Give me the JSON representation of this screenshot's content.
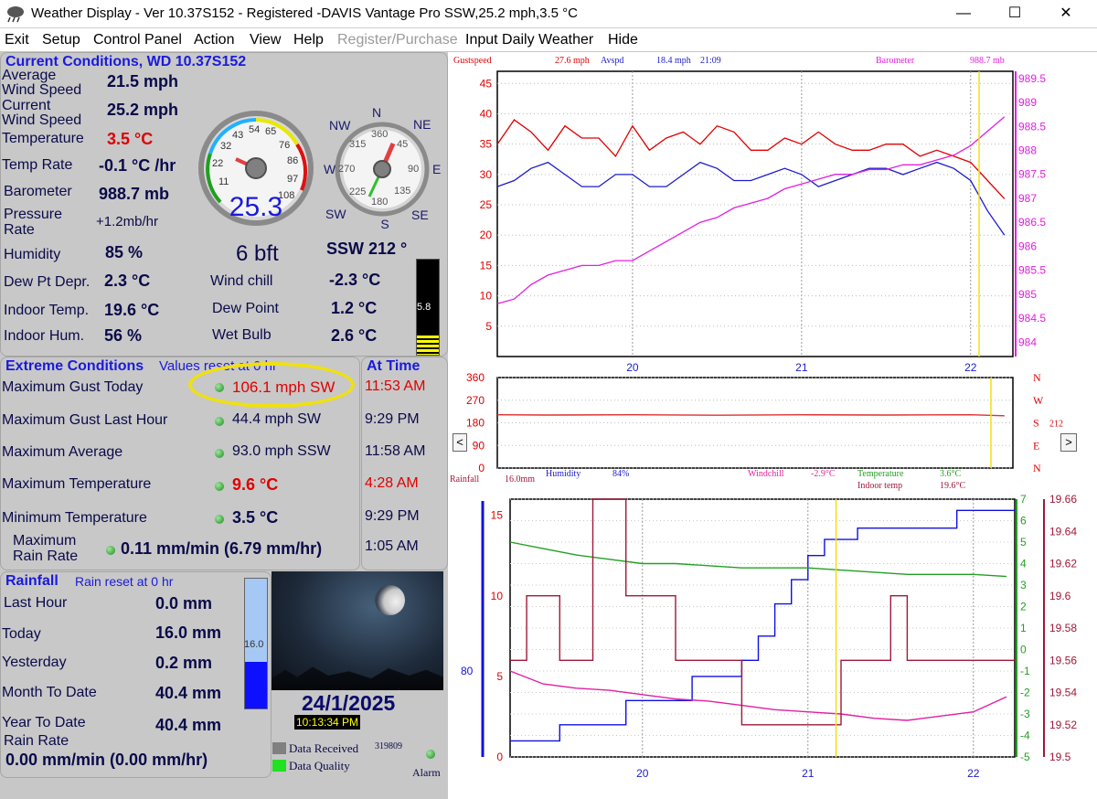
{
  "window": {
    "title": "Weather Display - Ver 10.37S152 - Registered  -DAVIS Vantage Pro SSW,25.2 mph,3.5 °C",
    "minimize": "—",
    "maximize": "☐",
    "close": "✕"
  },
  "menu": [
    "Exit",
    "Setup",
    "Control Panel",
    "Action",
    "View",
    "Help",
    "Register/Purchase",
    "Input Daily Weather",
    "Hide"
  ],
  "current": {
    "header": "Current Conditions, WD 10.37S152",
    "avg_wind_label": "Average\nWind Speed",
    "avg_wind": "21.5 mph",
    "cur_wind_label": "Current\nWind Speed",
    "cur_wind": "25.2 mph",
    "temp_label": "Temperature",
    "temp": "3.5 °C",
    "temp_rate_label": "Temp Rate",
    "temp_rate": "-0.1 °C /hr",
    "baro_label": "Barometer",
    "baro": "988.7 mb",
    "press_rate_label": "Pressure\nRate",
    "press_rate": "+1.2mb/hr",
    "humidity_label": "Humidity",
    "humidity": "85 %",
    "dewdep_label": "Dew Pt Depr.",
    "dewdep": "2.3 °C",
    "indoor_temp_label": "Indoor Temp.",
    "indoor_temp": "19.6 °C",
    "indoor_hum_label": "Indoor Hum.",
    "indoor_hum": "56 %",
    "bft": "6 bft",
    "windchill_label": "Wind chill",
    "windchill": "-2.3 °C",
    "dewpoint_label": "Dew Point",
    "dewpoint": "1.2 °C",
    "wetbulb_label": "Wet Bulb",
    "wetbulb": "2.6 °C",
    "direction": "SSW  212 °",
    "gauge_speed": "25.3",
    "gauge_ticks": [
      "11",
      "22",
      "32",
      "43",
      "54",
      "65",
      "76",
      "86",
      "97",
      "108"
    ],
    "compass_N": "N",
    "compass_NE": "NE",
    "compass_E": "E",
    "compass_SE": "SE",
    "compass_S": "S",
    "compass_SW": "SW",
    "compass_W": "W",
    "compass_NW": "NW",
    "compass_ticks": [
      "360",
      "45",
      "90",
      "135",
      "180",
      "225",
      "270",
      "315"
    ],
    "bar_value": "5.8",
    "bar_level": 0.2
  },
  "extreme": {
    "header": "Extreme Conditions",
    "sub": "Values reset at 0 hr",
    "at_time_header": "At Time",
    "rows": [
      {
        "label": "Maximum Gust Today",
        "value": "106.1 mph  SW",
        "time": "11:53 AM"
      },
      {
        "label": "Maximum Gust Last Hour",
        "value": "44.4 mph  SW",
        "time": "9:29 PM"
      },
      {
        "label": "Maximum Average",
        "value": "93.0 mph SSW",
        "time": "11:58 AM"
      },
      {
        "label": "Maximum Temperature",
        "value": "9.6 °C",
        "time": "4:28 AM"
      },
      {
        "label": "Minimum Temperature",
        "value": "3.5 °C",
        "time": "9:29 PM"
      },
      {
        "label": "Maximum\nRain Rate",
        "value": "0.11 mm/min (6.79 mm/hr)",
        "time": "1:05 AM"
      }
    ]
  },
  "rain": {
    "header": "Rainfall",
    "sub": "Rain reset at 0 hr",
    "last_hour_label": "Last Hour",
    "last_hour": "0.0 mm",
    "today_label": "Today",
    "today": "16.0 mm",
    "yesterday_label": "Yesterday",
    "yesterday": "0.2 mm",
    "month_label": "Month To Date",
    "month": "40.4 mm",
    "year_label": "Year To Date",
    "year": "40.4 mm",
    "rate_label": "Rain Rate",
    "rate": "0.00 mm/min (0.00 mm/hr)",
    "bar_value": "16.0",
    "bar_level": 0.36
  },
  "moon": {
    "date": "24/1/2025",
    "time": "10:13:34 PM"
  },
  "status": {
    "data_received_label": "Data Received",
    "data_quality_label": "Data Quality",
    "packets": "319809",
    "alarm_label": "Alarm"
  },
  "colors": {
    "gust": "#e00000",
    "avg": "#1c1ccc",
    "baro": "#e020e0",
    "dir": "#e03030",
    "green": "#22a022",
    "darkred": "#a01838",
    "blue": "#1010e0"
  },
  "chart_data": [
    {
      "type": "line",
      "title": "",
      "legend": [
        {
          "label": "Gustspeed",
          "value": "27.6 mph"
        },
        {
          "label": "Avspd",
          "value": "18.4 mph"
        },
        {
          "label": "21:09",
          "value": ""
        },
        {
          "label": "Barometer",
          "value": "988.7 mb"
        }
      ],
      "x_ticks": [
        "20",
        "21",
        "22"
      ],
      "xlim": [
        19.2,
        22.25
      ],
      "y_left_ticks": [
        "5",
        "10",
        "15",
        "20",
        "25",
        "30",
        "35",
        "40",
        "45"
      ],
      "ylim_left": [
        0,
        47
      ],
      "y_right_ticks": [
        "984",
        "984.5",
        "985",
        "985.5",
        "986",
        "986.5",
        "987",
        "987.5",
        "988",
        "988.5",
        "989",
        "989.5"
      ],
      "ylim_right": [
        983.7,
        989.65
      ],
      "series": [
        {
          "name": "Gustspeed",
          "axis": "left",
          "x": [
            19.2,
            19.3,
            19.4,
            19.5,
            19.6,
            19.7,
            19.8,
            19.9,
            20.0,
            20.1,
            20.2,
            20.3,
            20.4,
            20.5,
            20.6,
            20.7,
            20.8,
            20.9,
            21.0,
            21.1,
            21.2,
            21.3,
            21.4,
            21.5,
            21.6,
            21.7,
            21.8,
            21.9,
            22.0,
            22.1,
            22.2
          ],
          "y": [
            35,
            39,
            37,
            34,
            38,
            36,
            36,
            33,
            38,
            34,
            36,
            37,
            35,
            38,
            37,
            34,
            34,
            36,
            35,
            37,
            35,
            34,
            34,
            35,
            35,
            33,
            34,
            33,
            32,
            29,
            26
          ]
        },
        {
          "name": "Avspd",
          "axis": "left",
          "x": [
            19.2,
            19.3,
            19.4,
            19.5,
            19.6,
            19.7,
            19.8,
            19.9,
            20.0,
            20.1,
            20.2,
            20.3,
            20.4,
            20.5,
            20.6,
            20.7,
            20.8,
            20.9,
            21.0,
            21.1,
            21.2,
            21.3,
            21.4,
            21.5,
            21.6,
            21.7,
            21.8,
            21.9,
            22.0,
            22.1,
            22.2
          ],
          "y": [
            28,
            29,
            31,
            32,
            30,
            28,
            28,
            30,
            30,
            28,
            28,
            30,
            32,
            31,
            29,
            29,
            30,
            31,
            30,
            28,
            29,
            30,
            31,
            31,
            30,
            31,
            32,
            31,
            29,
            24,
            20
          ]
        },
        {
          "name": "Barometer",
          "axis": "right",
          "x": [
            19.2,
            19.3,
            19.4,
            19.5,
            19.6,
            19.7,
            19.8,
            19.9,
            20.0,
            20.1,
            20.2,
            20.3,
            20.4,
            20.5,
            20.6,
            20.7,
            20.8,
            20.9,
            21.0,
            21.1,
            21.2,
            21.3,
            21.4,
            21.5,
            21.6,
            21.7,
            21.8,
            21.9,
            22.0,
            22.1,
            22.2
          ],
          "y": [
            984.8,
            984.9,
            985.2,
            985.4,
            985.5,
            985.6,
            985.6,
            985.7,
            985.7,
            985.9,
            986.1,
            986.3,
            986.5,
            986.6,
            986.8,
            986.9,
            987.0,
            987.2,
            987.3,
            987.4,
            987.5,
            987.5,
            987.6,
            987.6,
            987.7,
            987.7,
            987.8,
            987.9,
            988.1,
            988.4,
            988.7
          ]
        }
      ]
    },
    {
      "type": "line",
      "title": "",
      "x_ticks": [],
      "xlim": [
        19.2,
        22.25
      ],
      "y_left_ticks": [
        "0",
        "90",
        "180",
        "270",
        "360"
      ],
      "ylim": [
        0,
        360
      ],
      "right_labels": [
        "N",
        "W",
        "S",
        "E",
        "N"
      ],
      "current_direction": "212",
      "series": [
        {
          "name": "",
          "x": [
            19.2,
            19.5,
            20.0,
            20.5,
            21.0,
            21.5,
            22.0,
            22.2
          ],
          "y": [
            212,
            211,
            212,
            210,
            212,
            211,
            212,
            208
          ]
        }
      ]
    },
    {
      "type": "line",
      "title": "",
      "legend": [
        {
          "label": "Rainfall",
          "value": "16.0mm"
        },
        {
          "label": "Humidity",
          "value": "84%"
        },
        {
          "label": "Windchill",
          "value": "-2.9°C"
        },
        {
          "label": "Temperature",
          "value": "3.6°C"
        },
        {
          "label": "Indoor temp",
          "value": "19.6°C"
        }
      ],
      "x_ticks": [
        "20",
        "21",
        "22"
      ],
      "xlim": [
        19.2,
        22.25
      ],
      "y_rain_ticks": [
        "0",
        "5",
        "10",
        "15"
      ],
      "ylim_rain": [
        0,
        16
      ],
      "y_hum_tick": "80",
      "y_temp_ticks": [
        "-5",
        "-4",
        "-3",
        "-2",
        "-1",
        "0",
        "1",
        "2",
        "3",
        "4",
        "5",
        "6",
        "7"
      ],
      "ylim_temp": [
        -5,
        7
      ],
      "y_indoor_ticks": [
        "19.5",
        "19.52",
        "19.54",
        "19.56",
        "19.58",
        "19.6",
        "19.62",
        "19.64",
        "19.66"
      ],
      "ylim_indoor": [
        19.5,
        19.66
      ],
      "series": [
        {
          "name": "Rainfall",
          "axis": "rain",
          "x": [
            19.2,
            19.5,
            19.5,
            19.9,
            19.9,
            20.3,
            20.3,
            20.6,
            20.6,
            20.7,
            20.7,
            20.8,
            20.8,
            20.9,
            20.9,
            21.0,
            21.0,
            21.1,
            21.1,
            21.3,
            21.3,
            21.4,
            21.4,
            21.9,
            21.9,
            22.25
          ],
          "y": [
            1.0,
            1.0,
            2.0,
            2.0,
            3.5,
            3.5,
            5.0,
            5.0,
            6.0,
            6.0,
            7.5,
            7.5,
            9.5,
            9.5,
            11.0,
            11.0,
            12.5,
            12.5,
            13.5,
            13.5,
            14.2,
            14.2,
            14.2,
            14.2,
            15.3,
            15.3
          ]
        },
        {
          "name": "Temperature",
          "axis": "temp",
          "x": [
            19.2,
            19.4,
            19.6,
            19.8,
            20.0,
            20.2,
            20.4,
            20.6,
            20.8,
            21.0,
            21.2,
            21.4,
            21.6,
            21.8,
            22.0,
            22.2
          ],
          "y": [
            5.0,
            4.7,
            4.4,
            4.2,
            4.0,
            4.0,
            3.9,
            3.8,
            3.8,
            3.8,
            3.7,
            3.6,
            3.5,
            3.5,
            3.5,
            3.4
          ]
        },
        {
          "name": "Windchill",
          "axis": "temp",
          "x": [
            19.2,
            19.4,
            19.6,
            19.8,
            20.0,
            20.2,
            20.4,
            20.6,
            20.8,
            21.0,
            21.2,
            21.4,
            21.6,
            21.8,
            22.0,
            22.2
          ],
          "y": [
            -1.0,
            -1.6,
            -1.8,
            -1.9,
            -2.1,
            -2.3,
            -2.4,
            -2.6,
            -2.8,
            -2.9,
            -3.0,
            -3.2,
            -3.3,
            -3.1,
            -2.9,
            -2.2
          ]
        },
        {
          "name": "Indoor temp",
          "axis": "indoor",
          "x": [
            19.2,
            19.3,
            19.3,
            19.5,
            19.5,
            19.7,
            19.7,
            19.9,
            19.9,
            20.2,
            20.2,
            20.6,
            20.6,
            21.2,
            21.2,
            21.5,
            21.5,
            21.6,
            21.6,
            22.25
          ],
          "y": [
            19.56,
            19.56,
            19.6,
            19.6,
            19.56,
            19.56,
            19.66,
            19.66,
            19.6,
            19.6,
            19.56,
            19.56,
            19.52,
            19.52,
            19.56,
            19.56,
            19.6,
            19.6,
            19.56,
            19.56
          ]
        }
      ]
    }
  ]
}
